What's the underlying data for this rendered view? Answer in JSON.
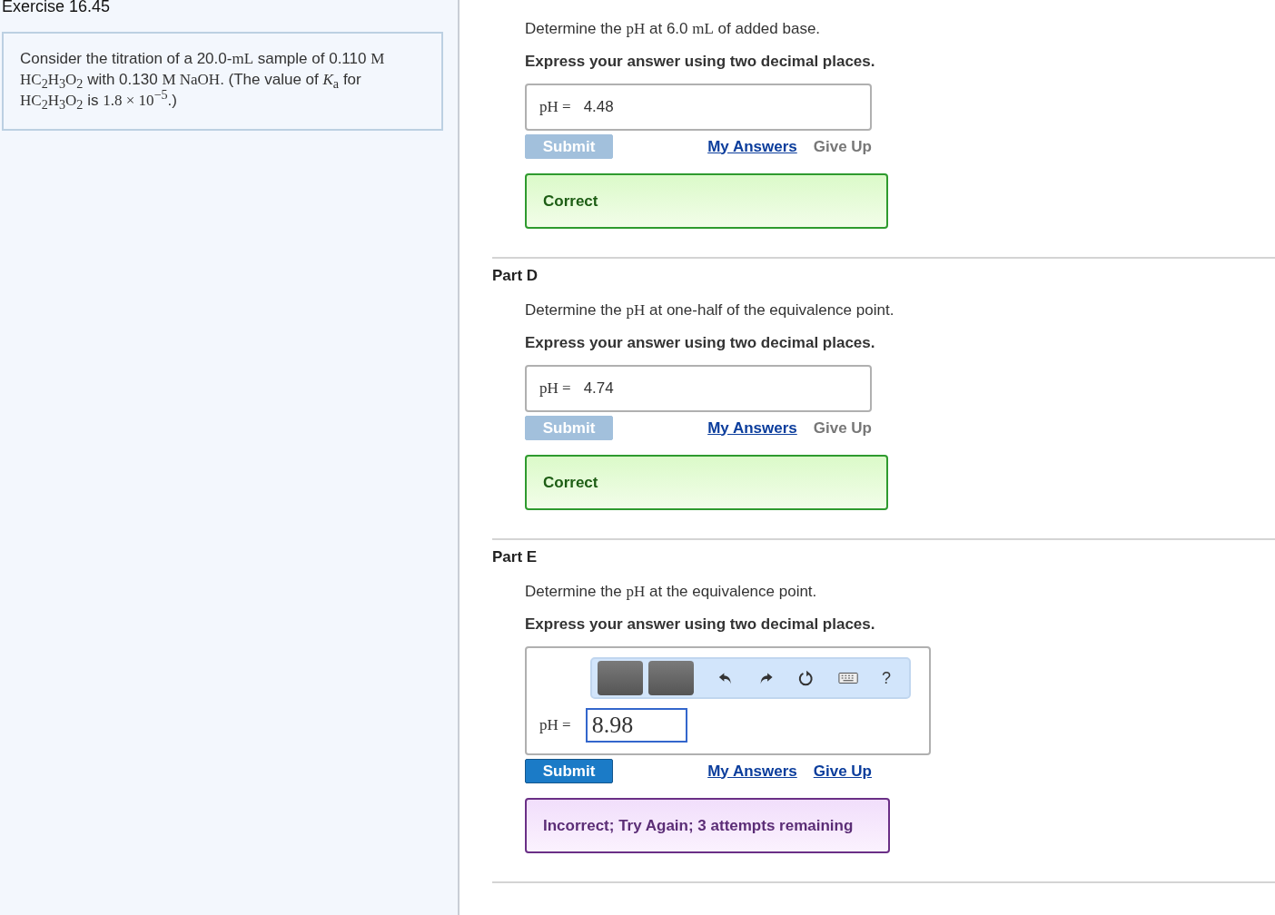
{
  "exercise": {
    "title": "Exercise 16.45",
    "problem": [
      {
        "kind": "text",
        "text": "Consider the titration of a 20.0-"
      },
      {
        "kind": "math",
        "text": "mL"
      },
      {
        "kind": "text",
        "text": " sample of 0.110 "
      },
      {
        "kind": "math",
        "text": "M"
      },
      {
        "kind": "math",
        "text": " HC$_{2}$H$_{3}$O$_{2}$"
      },
      {
        "kind": "text",
        "text": " with 0.130 "
      },
      {
        "kind": "math",
        "text": "M NaOH"
      },
      {
        "kind": "text",
        "text": ". (The value of "
      },
      {
        "kind": "math",
        "text": "*K*$_{a}$"
      },
      {
        "kind": "text",
        "text": " for "
      },
      {
        "kind": "math",
        "text": "HC$_{2}$H$_{3}$O$_{2}$"
      },
      {
        "kind": "text",
        "text": " is "
      },
      {
        "kind": "math",
        "text": "1.8 × 10$^{−5}$"
      },
      {
        "kind": "text",
        "text": ".)"
      }
    ]
  },
  "parts": [
    {
      "question": [
        {
          "kind": "text",
          "text": "Determine the "
        },
        {
          "kind": "math",
          "text": "pH"
        },
        {
          "kind": "text",
          "text": " at 6.0 "
        },
        {
          "kind": "math",
          "text": "mL"
        },
        {
          "kind": "text",
          "text": " of added base."
        }
      ],
      "instruction": "Express your answer using two decimal places.",
      "answer": {
        "kind": "simple",
        "label": "pH =",
        "value": "4.48"
      },
      "submit": {
        "label": "Submit",
        "disabled": true
      },
      "my_answers": "My Answers",
      "give_up": {
        "label": "Give Up",
        "disabled": true
      },
      "feedback": {
        "kind": "correct",
        "text": "Correct"
      }
    },
    {
      "heading": "Part D",
      "question": [
        {
          "kind": "text",
          "text": "Determine the "
        },
        {
          "kind": "math",
          "text": "pH"
        },
        {
          "kind": "text",
          "text": " at one-half of the equivalence point."
        }
      ],
      "instruction": "Express your answer using two decimal places.",
      "answer": {
        "kind": "simple",
        "label": "pH =",
        "value": "4.74"
      },
      "submit": {
        "label": "Submit",
        "disabled": true
      },
      "my_answers": "My Answers",
      "give_up": {
        "label": "Give Up",
        "disabled": true
      },
      "feedback": {
        "kind": "correct",
        "text": "Correct"
      }
    },
    {
      "heading": "Part E",
      "question": [
        {
          "kind": "text",
          "text": "Determine the "
        },
        {
          "kind": "math",
          "text": "pH"
        },
        {
          "kind": "text",
          "text": " at the equivalence point."
        }
      ],
      "instruction": "Express your answer using two decimal places.",
      "answer": {
        "kind": "editor",
        "label": "pH =",
        "value": "8.98",
        "toolbar": {
          "help": "?"
        }
      },
      "submit": {
        "label": "Submit",
        "disabled": false
      },
      "my_answers": "My Answers",
      "give_up": {
        "label": "Give Up",
        "disabled": false
      },
      "feedback": {
        "kind": "incorrect",
        "text": "Incorrect; Try Again; 3 attempts remaining"
      }
    }
  ]
}
